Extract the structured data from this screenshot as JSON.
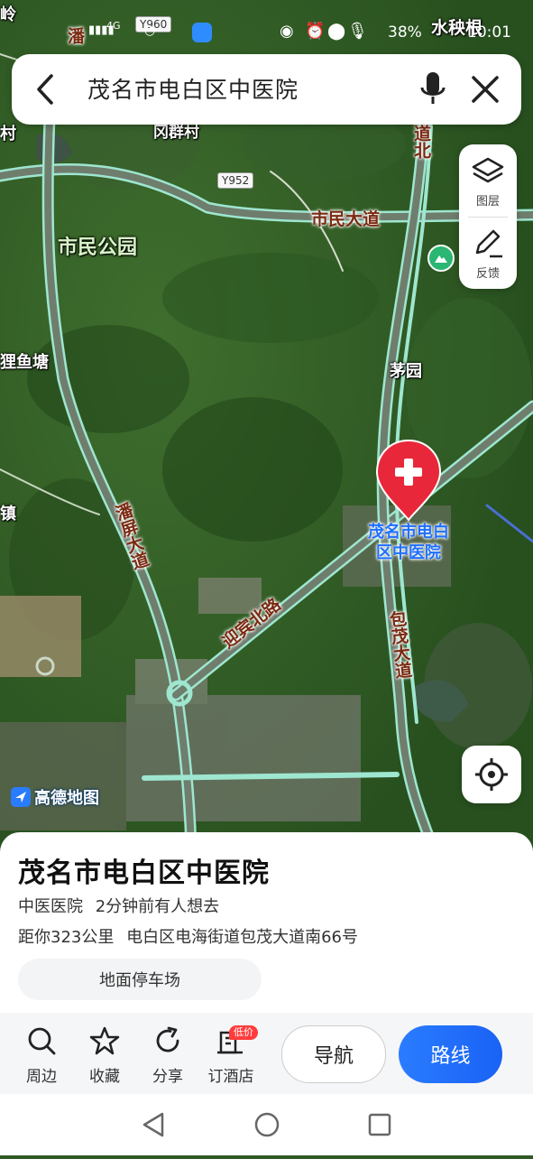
{
  "status_bar": {
    "time": "10:01",
    "battery": "38%",
    "carrier_hint": "4G"
  },
  "search": {
    "query": "茂名市电白区中医院"
  },
  "map": {
    "place_labels": {
      "park": "市民公园",
      "village_qunqun": "冈群村",
      "maoyuan": "茅园",
      "liyutang": "狸鱼塘",
      "cun_left": "村",
      "zhen_left": "镇",
      "ling_left": "岭",
      "pan_top": "潘",
      "shuiyanggen": "水秧根"
    },
    "road_labels": {
      "shimin_avenue": "市民大道",
      "panping_avenue": "潘屏大道",
      "yingbin_north_road": "迎宾北路",
      "baomao_avenue": "包茂大道",
      "dao_bei": "道北"
    },
    "road_badges": [
      "Y952",
      "Y960"
    ],
    "poi_marker_label": "茂名市电白区中医院",
    "brand": "高德地图"
  },
  "map_tools": {
    "layers_label": "图层",
    "feedback_label": "反馈"
  },
  "place": {
    "name": "茂名市电白区中医院",
    "category": "中医医院",
    "interest": "2分钟前有人想去",
    "distance": "距你323公里",
    "address": "电白区电海街道包茂大道南66号",
    "parking_chip": "地面停车场"
  },
  "actions": {
    "nearby": "周边",
    "favorite": "收藏",
    "share": "分享",
    "hotel": "订酒店",
    "hotel_badge": "低价",
    "navigate": "导航",
    "route": "路线"
  },
  "colors": {
    "accent": "#1a62f5",
    "poi_red": "#e8283a",
    "road_outline": "#9ee6d0"
  }
}
